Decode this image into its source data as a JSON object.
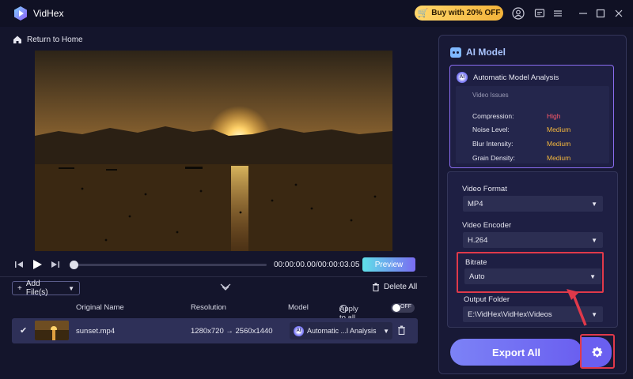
{
  "app": {
    "title": "VidHex"
  },
  "header": {
    "buy_label": "Buy with 20% OFF",
    "icons": [
      "user-icon",
      "feedback-icon",
      "menu-icon",
      "minimize-icon",
      "maximize-icon",
      "close-icon"
    ]
  },
  "nav": {
    "return_label": "Return to Home"
  },
  "player": {
    "timecode": "00:00:00.00/00:00:03.05",
    "preview_label": "Preview",
    "progress_fraction": 0.0
  },
  "file_list": {
    "add_files_label": "Add File(s)",
    "delete_all_label": "Delete All",
    "columns": {
      "original_name": "Original Name",
      "resolution": "Resolution",
      "model": "Model",
      "apply_to_all": "Apply to all",
      "toggle_state": "OFF"
    },
    "rows": [
      {
        "name": "sunset.mp4",
        "resolution_from": "1280x720",
        "resolution_to": "2560x1440",
        "model": "Automatic ...l Analysis"
      }
    ]
  },
  "ai_panel": {
    "title": "AI Model",
    "analysis_title": "Automatic Model Analysis",
    "issues_label": "Video Issues",
    "issues": [
      {
        "name": "Compression:",
        "value": "High",
        "color": "#ff5a6a"
      },
      {
        "name": "Noise Level:",
        "value": "Medium",
        "color": "#f5b83d"
      },
      {
        "name": "Blur Intensity:",
        "value": "Medium",
        "color": "#f5b83d"
      },
      {
        "name": "Grain Density:",
        "value": "Medium",
        "color": "#f5b83d"
      }
    ]
  },
  "settings": {
    "video_format_label": "Video Format",
    "video_format_value": "MP4",
    "video_encoder_label": "Video Encoder",
    "video_encoder_value": "H.264",
    "bitrate_label": "Bitrate",
    "bitrate_value": "Auto",
    "output_folder_label": "Output Folder",
    "output_folder_value": "E:\\VidHex\\VidHex\\Videos"
  },
  "export": {
    "label": "Export All"
  },
  "colors": {
    "accent": "#6a5ff0",
    "highlight": "#e0394a",
    "buy_gold": "#f3b33a"
  }
}
